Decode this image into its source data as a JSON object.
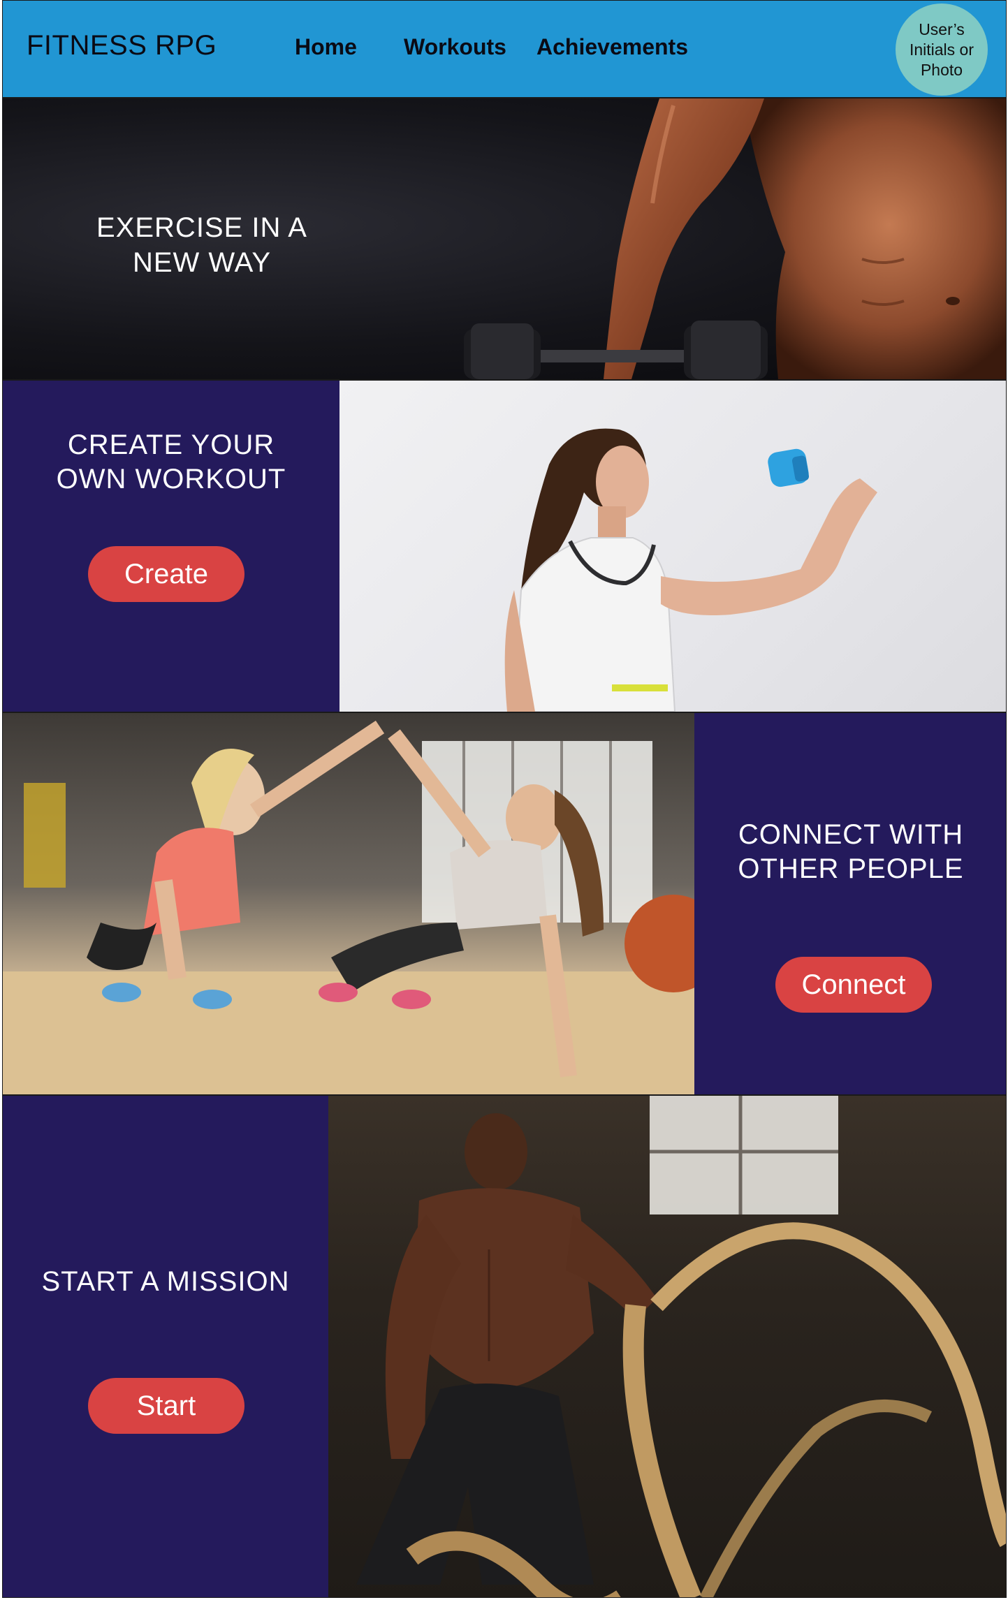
{
  "header": {
    "brand": "FITNESS RPG",
    "nav": [
      {
        "label": "Home"
      },
      {
        "label": "Workouts"
      },
      {
        "label": "Achievements"
      }
    ],
    "avatar_text": "User’s Initials or Photo"
  },
  "hero": {
    "title": "EXERCISE IN A NEW WAY"
  },
  "sections": [
    {
      "title": "CREATE YOUR OWN WORKOUT",
      "button": "Create"
    },
    {
      "title": "CONNECT WITH OTHER PEOPLE",
      "button": "Connect"
    },
    {
      "title": "START A MISSION",
      "button": "Start"
    }
  ],
  "colors": {
    "header_bg": "#2196d3",
    "panel_bg": "#241a5c",
    "button_bg": "#d94343",
    "avatar_bg": "#7fc9c5"
  }
}
